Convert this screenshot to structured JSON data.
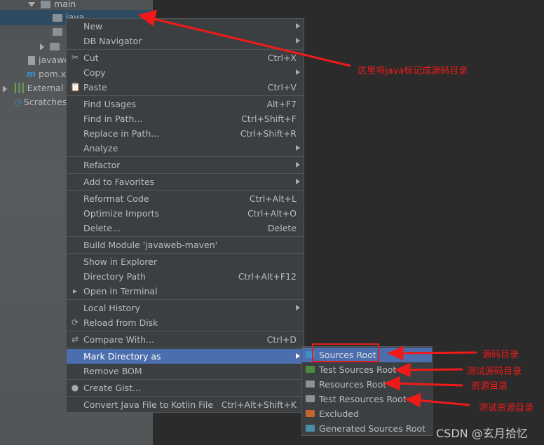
{
  "tree": [
    {
      "label": "main"
    },
    {
      "label": "java"
    },
    {
      "label": "javaweb"
    },
    {
      "label": "pom.x"
    },
    {
      "label": "External L"
    },
    {
      "label": "Scratches"
    }
  ],
  "menu": [
    {
      "label": "New",
      "shortcut": "",
      "submenu": true
    },
    {
      "label": "DB Navigator",
      "shortcut": "",
      "submenu": true
    },
    {
      "sep": true
    },
    {
      "label": "Cut",
      "shortcut": "Ctrl+X",
      "icon": "scissors-icon",
      "glyph": "✂"
    },
    {
      "label": "Copy",
      "shortcut": "",
      "submenu": true
    },
    {
      "label": "Paste",
      "shortcut": "Ctrl+V",
      "icon": "clipboard-icon",
      "glyph": "📋"
    },
    {
      "sep": true
    },
    {
      "label": "Find Usages",
      "shortcut": "Alt+F7"
    },
    {
      "label": "Find in Path...",
      "shortcut": "Ctrl+Shift+F"
    },
    {
      "label": "Replace in Path...",
      "shortcut": "Ctrl+Shift+R"
    },
    {
      "label": "Analyze",
      "shortcut": "",
      "submenu": true
    },
    {
      "sep": true
    },
    {
      "label": "Refactor",
      "shortcut": "",
      "submenu": true
    },
    {
      "sep": true
    },
    {
      "label": "Add to Favorites",
      "shortcut": "",
      "submenu": true
    },
    {
      "sep": true
    },
    {
      "label": "Reformat Code",
      "shortcut": "Ctrl+Alt+L"
    },
    {
      "label": "Optimize Imports",
      "shortcut": "Ctrl+Alt+O"
    },
    {
      "label": "Delete...",
      "shortcut": "Delete"
    },
    {
      "sep": true
    },
    {
      "label": "Build Module 'javaweb-maven'",
      "shortcut": ""
    },
    {
      "sep": true
    },
    {
      "label": "Show in Explorer",
      "shortcut": ""
    },
    {
      "label": "Directory Path",
      "shortcut": "Ctrl+Alt+F12"
    },
    {
      "label": "Open in Terminal",
      "shortcut": "",
      "icon": "terminal-icon",
      "glyph": "▸"
    },
    {
      "sep": true
    },
    {
      "label": "Local History",
      "shortcut": "",
      "submenu": true
    },
    {
      "label": "Reload from Disk",
      "shortcut": "",
      "icon": "reload-icon",
      "glyph": "⟳"
    },
    {
      "sep": true
    },
    {
      "label": "Compare With...",
      "shortcut": "Ctrl+D",
      "icon": "compare-icon",
      "glyph": "⇄"
    },
    {
      "sep": true
    },
    {
      "label": "Mark Directory as",
      "shortcut": "",
      "submenu": true,
      "highlighted": true
    },
    {
      "label": "Remove BOM",
      "shortcut": ""
    },
    {
      "sep": true
    },
    {
      "label": "Create Gist...",
      "shortcut": "",
      "icon": "github-icon",
      "glyph": "●"
    },
    {
      "sep": true
    },
    {
      "label": "Convert Java File to Kotlin File",
      "shortcut": "Ctrl+Alt+Shift+K"
    }
  ],
  "submenu": [
    {
      "label": "Sources Root",
      "color": "#3d8fc6",
      "highlighted": true
    },
    {
      "label": "Test Sources Root",
      "color": "#4e8a3e"
    },
    {
      "label": "Resources Root",
      "color": "#8a9299"
    },
    {
      "label": "Test Resources Root",
      "color": "#8a9299"
    },
    {
      "label": "Excluded",
      "color": "#c0662e"
    },
    {
      "label": "Generated Sources Root",
      "color": "#4a8ca8"
    }
  ],
  "annotations": {
    "java": "这里将java标记成源码目录",
    "sources": "源码目录",
    "test_sources": "测试源码目录",
    "resources": "资源目录",
    "test_resources": "测试资源目录"
  },
  "watermark": "CSDN @玄月拾忆",
  "colors": {
    "menu_bg": "#3c3f41",
    "highlight": "#4b6eaf",
    "annotation": "#f01a1a"
  }
}
